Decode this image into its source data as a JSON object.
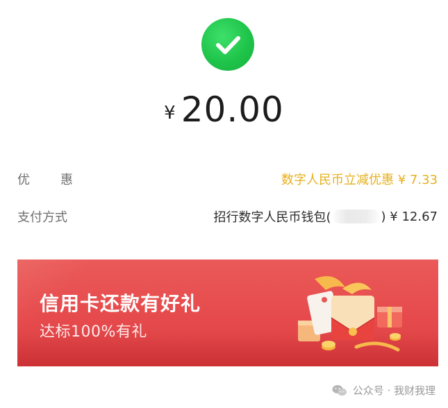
{
  "status": {
    "icon": "checkmark-icon",
    "color": "#1fc44a"
  },
  "amount": {
    "currency": "¥",
    "value": "20.00"
  },
  "details": {
    "discount": {
      "label": "优惠",
      "value": "数字人民币立减优惠 ¥ 7.33",
      "color": "#e6b01e"
    },
    "payment_method": {
      "label": "支付方式",
      "wallet": "招行数字人民币钱包(",
      "amount": ") ¥ 12.67"
    }
  },
  "banner": {
    "title": "信用卡还款有好礼",
    "subtitle": "达标100%有礼",
    "background": "#e64a4c"
  },
  "watermark": {
    "text": "公众号 · 我财我理",
    "icon": "wechat-icon"
  }
}
